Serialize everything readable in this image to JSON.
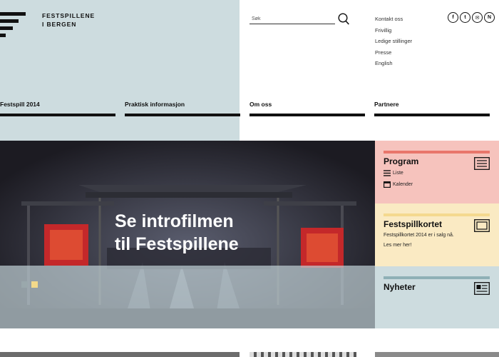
{
  "logo": {
    "line1": "FESTSPILLENE",
    "line2": "I BERGEN"
  },
  "search": {
    "placeholder": "Søk"
  },
  "utility_links": [
    "Kontakt oss",
    "Frivillig",
    "Ledige stillinger",
    "Presse",
    "English"
  ],
  "social": [
    {
      "icon": "facebook-icon",
      "glyph": "f"
    },
    {
      "icon": "twitter-icon",
      "glyph": "t"
    },
    {
      "icon": "mail-icon",
      "glyph": "✉"
    },
    {
      "icon": "issuu-icon",
      "glyph": "N"
    }
  ],
  "nav": [
    {
      "label": "Festspill 2014"
    },
    {
      "label": "Praktisk informasjon"
    },
    {
      "label": "Om oss"
    },
    {
      "label": "Partnere"
    }
  ],
  "hero": {
    "line1": "Se introfilmen",
    "line2": "til Festspillene"
  },
  "slider_dots": [
    {
      "color": "#9aa8ac"
    },
    {
      "color": "#f3d98a"
    }
  ],
  "panels": {
    "program": {
      "title": "Program",
      "bg": "#f6c3bd",
      "rule": "#e9766b",
      "links": [
        {
          "icon": "list-icon",
          "label": "Liste"
        },
        {
          "icon": "calendar-icon",
          "label": "Kalender"
        }
      ]
    },
    "festspillkortet": {
      "title": "Festspillkortet",
      "bg": "#faeac3",
      "rule": "#f4d98f",
      "text": "Festspillkortet 2014 er i salg nå.",
      "link": "Les mer her!"
    },
    "nyheter": {
      "title": "Nyheter",
      "bg": "#cddcdf",
      "rule": "#8fb0b6"
    }
  },
  "colors": {
    "header_bg": "#cddcdf",
    "text": "#111111"
  }
}
